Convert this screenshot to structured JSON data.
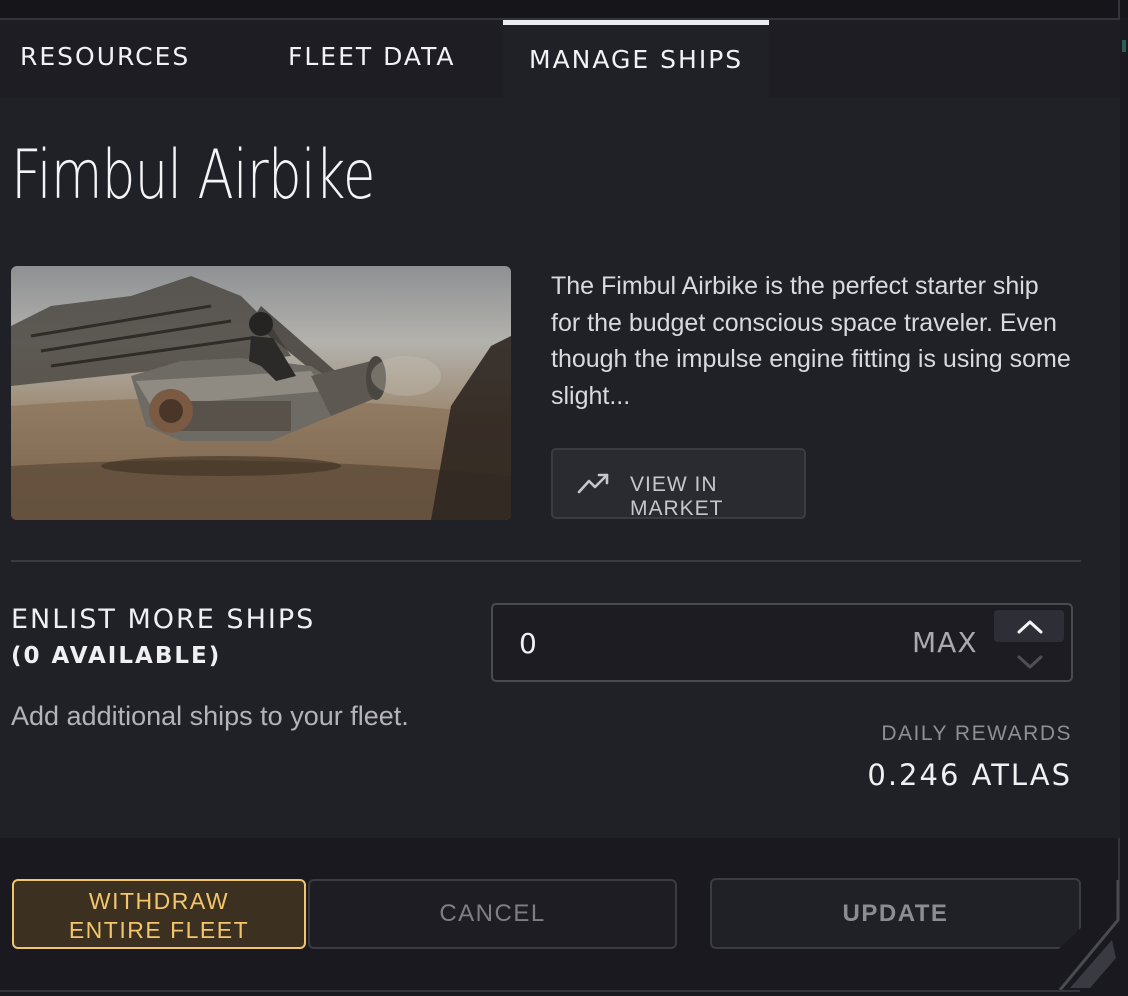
{
  "tabs": {
    "resources": "RESOURCES",
    "fleet_data": "FLEET DATA",
    "manage_ships": "MANAGE SHIPS",
    "active": "MANAGE SHIPS"
  },
  "ship": {
    "name": "Fimbul Airbike",
    "description": "The Fimbul Airbike is the perfect starter ship for the budget conscious space traveler. Even though the impulse engine fitting is using some slight...",
    "market_button": "VIEW IN MARKET"
  },
  "enlist": {
    "title": "ENLIST MORE SHIPS",
    "available": "(0 AVAILABLE)",
    "subtitle": "Add additional ships to your fleet.",
    "quantity": "0",
    "max_label": "MAX"
  },
  "rewards": {
    "label": "DAILY REWARDS",
    "value": "0.246 ATLAS"
  },
  "actions": {
    "withdraw_line1": "WITHDRAW",
    "withdraw_line2": "ENTIRE FLEET",
    "cancel": "CANCEL",
    "update": "UPDATE"
  },
  "colors": {
    "background": "#19191f",
    "panel": "#202027",
    "accent_gold": "#f4c56d",
    "text_primary": "#f0f0f3",
    "text_muted": "#8e8e95"
  },
  "icons": {
    "market": "trending-up-icon",
    "step_up": "chevron-up-icon",
    "step_down": "chevron-down-icon"
  }
}
